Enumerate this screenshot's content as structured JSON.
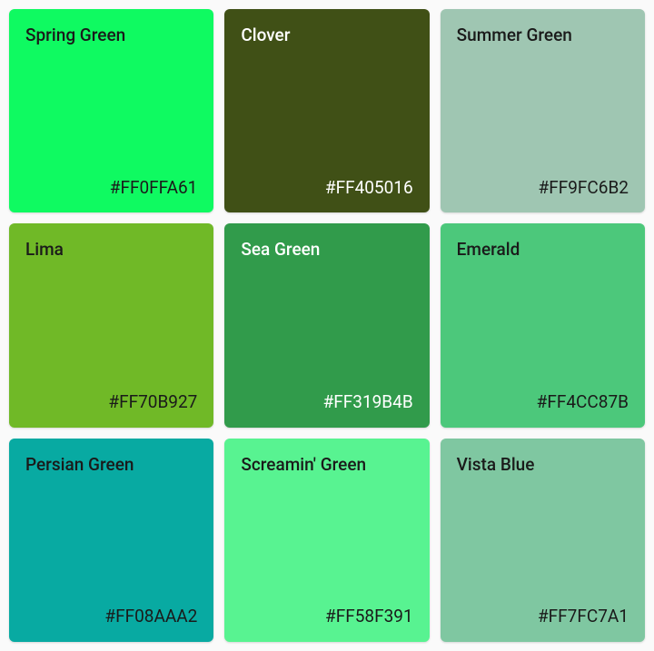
{
  "swatches": [
    {
      "name": "Spring Green",
      "code": "#FF0FFA61",
      "bg": "#0FFA61",
      "textClass": "dark-text"
    },
    {
      "name": "Clover",
      "code": "#FF405016",
      "bg": "#405016",
      "textClass": "light-text"
    },
    {
      "name": "Summer Green",
      "code": "#FF9FC6B2",
      "bg": "#9FC6B2",
      "textClass": "dark-text"
    },
    {
      "name": "Lima",
      "code": "#FF70B927",
      "bg": "#70B927",
      "textClass": "dark-text"
    },
    {
      "name": "Sea Green",
      "code": "#FF319B4B",
      "bg": "#319B4B",
      "textClass": "light-text"
    },
    {
      "name": "Emerald",
      "code": "#FF4CC87B",
      "bg": "#4CC87B",
      "textClass": "dark-text"
    },
    {
      "name": "Persian Green",
      "code": "#FF08AAA2",
      "bg": "#08AAA2",
      "textClass": "dark-text"
    },
    {
      "name": "Screamin' Green",
      "code": "#FF58F391",
      "bg": "#58F391",
      "textClass": "dark-text"
    },
    {
      "name": "Vista Blue",
      "code": "#FF7FC7A1",
      "bg": "#7FC7A1",
      "textClass": "dark-text"
    }
  ]
}
